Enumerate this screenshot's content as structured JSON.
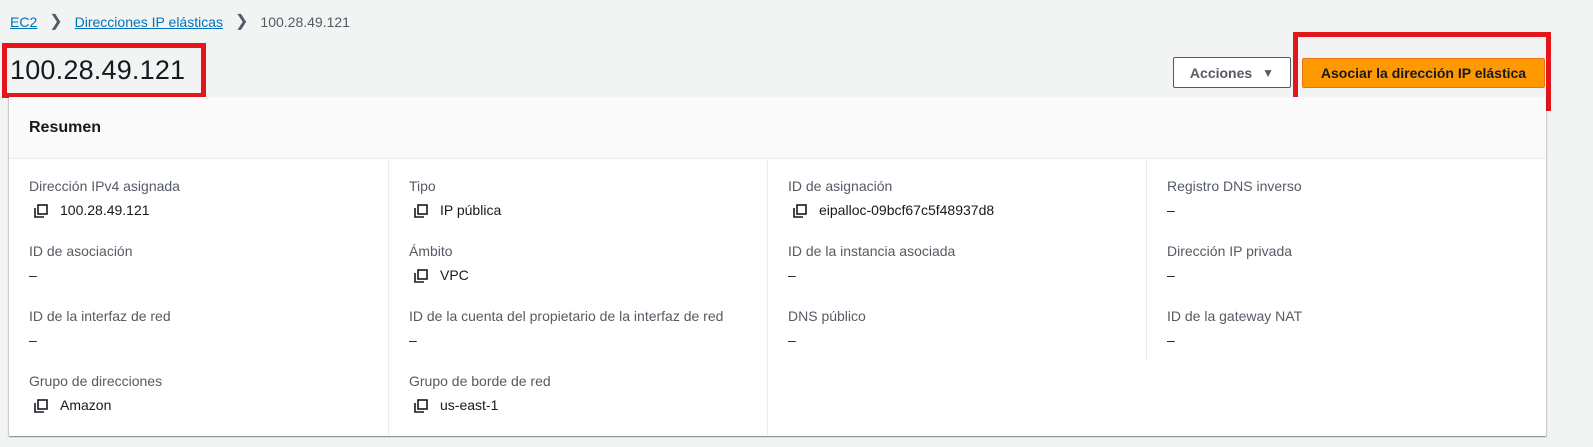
{
  "breadcrumb": {
    "items": [
      "EC2",
      "Direcciones IP elásticas"
    ],
    "current": "100.28.49.121"
  },
  "page": {
    "title": "100.28.49.121"
  },
  "buttons": {
    "actions_label": "Acciones",
    "associate_label": "Asociar la dirección IP elástica"
  },
  "summary": {
    "title": "Resumen",
    "columns": [
      [
        {
          "label": "Dirección IPv4 asignada",
          "value": "100.28.49.121",
          "copy": true
        },
        {
          "label": "ID de asociación",
          "value": "–",
          "copy": false
        },
        {
          "label": "ID de la interfaz de red",
          "value": "–",
          "copy": false
        },
        {
          "label": "Grupo de direcciones",
          "value": "Amazon",
          "copy": true
        }
      ],
      [
        {
          "label": "Tipo",
          "value": "IP pública",
          "copy": true
        },
        {
          "label": "Ámbito",
          "value": "VPC",
          "copy": true
        },
        {
          "label": "ID de la cuenta del propietario de la interfaz de red",
          "value": "–",
          "copy": false
        },
        {
          "label": "Grupo de borde de red",
          "value": "us-east-1",
          "copy": true
        }
      ],
      [
        {
          "label": "ID de asignación",
          "value": "eipalloc-09bcf67c5f48937d8",
          "copy": true
        },
        {
          "label": "ID de la instancia asociada",
          "value": "–",
          "copy": false
        },
        {
          "label": "DNS público",
          "value": "–",
          "copy": false
        }
      ],
      [
        {
          "label": "Registro DNS inverso",
          "value": "–",
          "copy": false
        },
        {
          "label": "Dirección IP privada",
          "value": "–",
          "copy": false
        },
        {
          "label": "ID de la gateway NAT",
          "value": "–",
          "copy": false
        }
      ]
    ]
  },
  "colors": {
    "link": "#0073bb",
    "primary_button": "#ff9900",
    "highlight_box": "#e4161b"
  }
}
